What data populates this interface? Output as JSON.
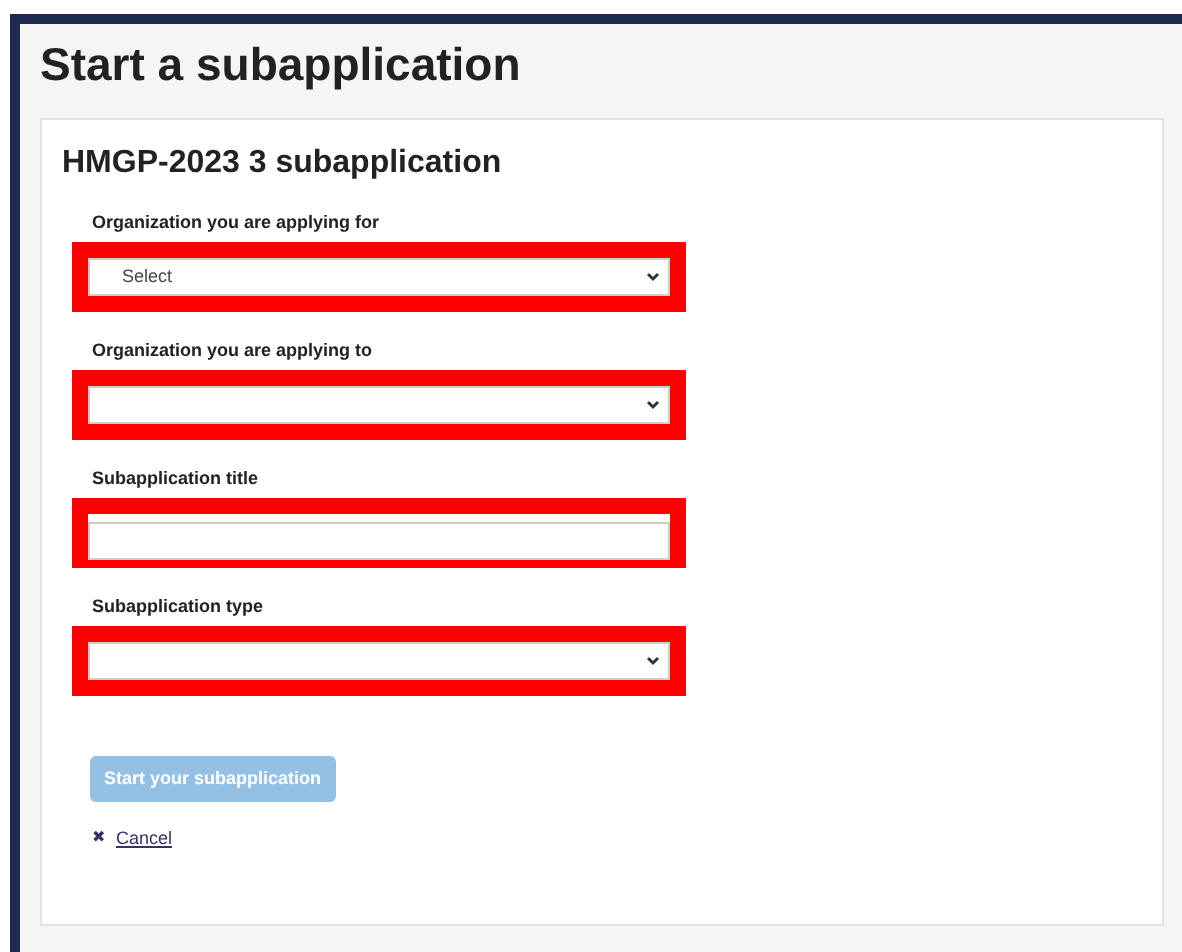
{
  "page": {
    "title": "Start a subapplication"
  },
  "card": {
    "title": "HMGP-2023 3 subapplication",
    "fields": [
      {
        "label": "Organization you are applying for",
        "kind": "select",
        "value": "Select",
        "highlighted": true
      },
      {
        "label": "Organization you are applying to",
        "kind": "select",
        "highlighted": true
      },
      {
        "label": "Subapplication title",
        "kind": "text",
        "highlighted": true
      },
      {
        "label": "Subapplication type",
        "kind": "select",
        "highlighted": true
      }
    ],
    "submit": {
      "label": "Start your subapplication",
      "disabled": true
    },
    "cancel": {
      "icon": "✖",
      "label": "Cancel"
    }
  }
}
